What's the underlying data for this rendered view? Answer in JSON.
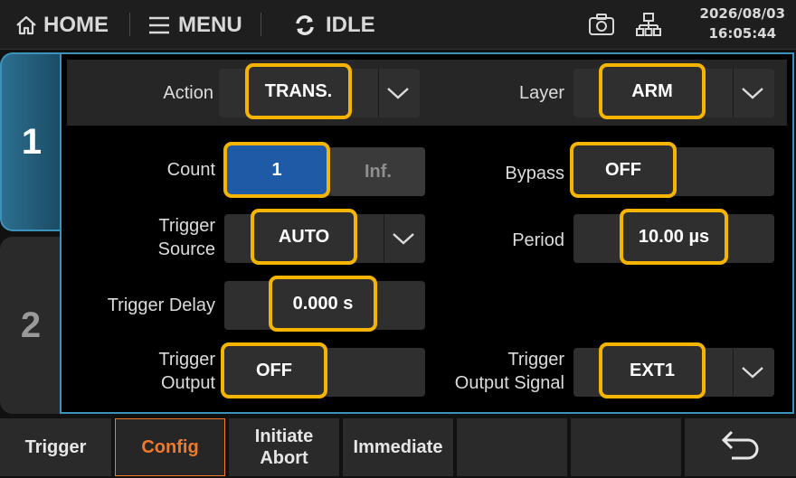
{
  "topbar": {
    "home_label": "HOME",
    "menu_label": "MENU",
    "status_label": "IDLE",
    "date": "2026/08/03",
    "time": "16:05:44"
  },
  "tabs": [
    {
      "label": "1",
      "active": true
    },
    {
      "label": "2",
      "active": false
    }
  ],
  "header": {
    "action_label": "Action",
    "action_value": "TRANS.",
    "layer_label": "Layer",
    "layer_value": "ARM"
  },
  "settings": {
    "count_label": "Count",
    "count_value": "1",
    "count_inf": "Inf.",
    "bypass_label": "Bypass",
    "bypass_value": "OFF",
    "trigger_source_label_1": "Trigger",
    "trigger_source_label_2": "Source",
    "trigger_source_value": "AUTO",
    "period_label": "Period",
    "period_value": "10.00 µs",
    "trigger_delay_label": "Trigger Delay",
    "trigger_delay_value": "0.000 s",
    "trigger_output_label_1": "Trigger",
    "trigger_output_label_2": "Output",
    "trigger_output_value": "OFF",
    "trigger_output_signal_label_1": "Trigger",
    "trigger_output_signal_label_2": "Output Signal",
    "trigger_output_signal_value": "EXT1"
  },
  "softkeys": {
    "trigger": "Trigger",
    "config": "Config",
    "initiate": "Initiate",
    "abort": "Abort",
    "immediate": "Immediate"
  },
  "colors": {
    "highlight": "#f5b400",
    "accent": "#3b93bb",
    "active_softkey": "#f07a2a",
    "count_selected": "#1f5aa6"
  }
}
